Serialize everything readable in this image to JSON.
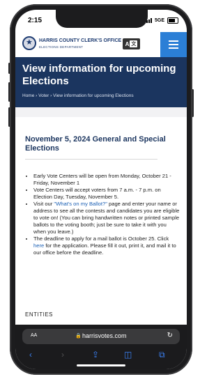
{
  "status_bar": {
    "time": "2:15",
    "network": "5GE"
  },
  "header": {
    "org_name": "HARRIS COUNTY CLERK'S OFFICE",
    "org_subtitle": "ELECTIONS DEPARTMENT",
    "translate_label_a": "A",
    "translate_label_b": "文"
  },
  "hero": {
    "title": "View information for upcoming Elections",
    "breadcrumb": [
      "Home",
      "Voter",
      "View information for upcoming Elections"
    ]
  },
  "article": {
    "heading": "November 5, 2024 General and Special Elections",
    "bullet_1": "Early Vote Centers will be open from Monday, October 21 - Friday, November 1",
    "bullet_2": "Vote Centers will accept voters from 7 a.m. - 7 p.m. on Election Day, Tuesday, November 5.",
    "bullet_3_pre": "Visit our ",
    "bullet_3_link": "\"What's on my Ballot?\"",
    "bullet_3_post": " page and enter your name or address to see all the contests and candidates you are eligible to vote on! (You can bring handwritten notes or printed sample ballots to the voting booth; just be sure to take it with you when you leave.)",
    "bullet_4_pre": "The deadline to apply for a mail ballot is October 25. Click ",
    "bullet_4_link": "here",
    "bullet_4_post": " for the application. Please fill it out, print it, and mail it to our office before the deadline.",
    "section_label": "ENTITIES"
  },
  "browser": {
    "text_size": "AA",
    "url": "harrisvotes.com",
    "lock_icon": "lock-icon",
    "reload_icon": "reload-icon"
  }
}
